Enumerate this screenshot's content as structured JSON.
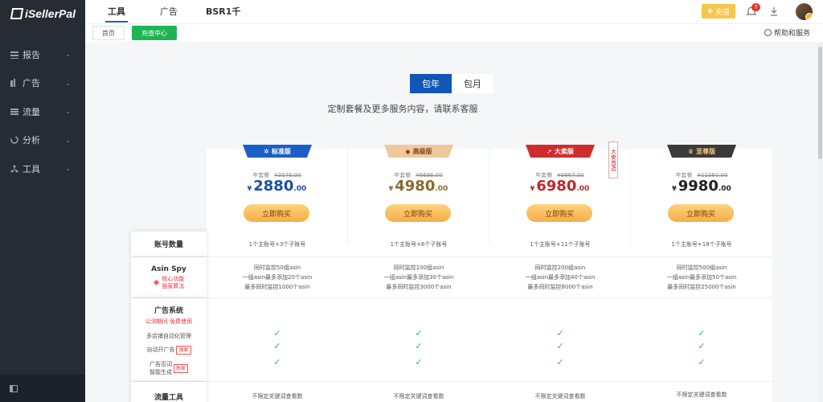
{
  "app": {
    "logo": "iSellerPal"
  },
  "sidebar": {
    "items": [
      {
        "label": "报告",
        "icon": "report-icon"
      },
      {
        "label": "广告",
        "icon": "ad-icon"
      },
      {
        "label": "流量",
        "icon": "traffic-icon"
      },
      {
        "label": "分析",
        "icon": "analysis-icon"
      },
      {
        "label": "工具",
        "icon": "tools-icon"
      }
    ]
  },
  "header": {
    "tabs": [
      "工具",
      "广告",
      "BSR1千"
    ],
    "recharge": "充值",
    "notifications": "7"
  },
  "breadcrumb": {
    "home": "首页",
    "current": "充值中心",
    "help": "帮助和服务"
  },
  "billing": {
    "yearly": "包年",
    "monthly": "包月",
    "subtitle": "定制套餐及更多服务内容，请联系客服"
  },
  "plans": [
    {
      "name": "标准版",
      "term": "年套餐",
      "original": "¥3576.00",
      "currency": "¥",
      "price": "2880",
      "dec": ".00",
      "color": "#1a5fc8",
      "buy": "立即购买"
    },
    {
      "name": "高级版",
      "term": "年套餐",
      "original": "¥6696.00",
      "currency": "¥",
      "price": "4980",
      "dec": ".00",
      "color": "#e6a66a",
      "buy": "立即购买"
    },
    {
      "name": "大卖版",
      "term": "年套餐",
      "original": "¥9867.00",
      "currency": "¥",
      "price": "6980",
      "dec": ".00",
      "color": "#cf2d2d",
      "buy": "立即购买"
    },
    {
      "name": "至尊版",
      "term": "年套餐",
      "original": "¥12360.00",
      "currency": "¥",
      "price": "9980",
      "dec": ".00",
      "color": "#3a3a3a",
      "buy": "立即购买"
    }
  ],
  "hot_tag": "大卖首选",
  "features": {
    "accounts": {
      "label": "账号数量",
      "values": [
        "1个主账号+3个子账号",
        "1个主账号+6个子账号",
        "1个主账号+11个子账号",
        "1个主账号+18个子账号"
      ]
    },
    "asin": {
      "label": "Asin Spy",
      "note1": "核心功能",
      "note2": "独家算法",
      "values": [
        [
          "同时监控50组asin",
          "一组asin最多添加20个asin",
          "最多同时监控1000个asin"
        ],
        [
          "同时监控100组asin",
          "一组asin最多添加30个asin",
          "最多同时监控3000个asin"
        ],
        [
          "同时监控200组asin",
          "一组asin最多添加40个asin",
          "最多同时监控8000个asin"
        ],
        [
          "同时监控500组asin",
          "一组asin最多添加50个asin",
          "最多同时监控25000个asin"
        ]
      ]
    },
    "ads": {
      "label": "广告系统",
      "note": "公测期间 免费使用",
      "sub1": "多店铺自动化管理",
      "sub2": "自动开广告",
      "sub3a": "广告否词",
      "sub3b": "智能生成",
      "tag": "独家",
      "check": "✓"
    },
    "traffic": {
      "label": "流量工具",
      "values": [
        "不限定关键词查看数",
        "不限定关键词查看数",
        "不限定关键词查看数",
        "不限定关键词查看数"
      ]
    }
  }
}
